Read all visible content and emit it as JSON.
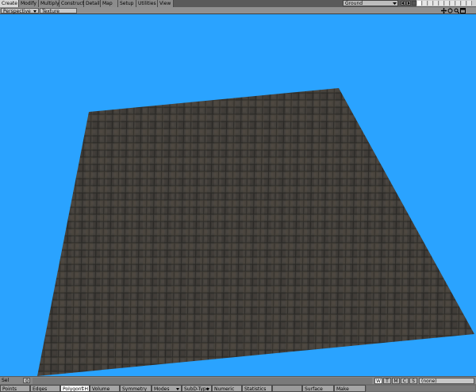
{
  "toolbar": {
    "tabs": [
      "Create",
      "Modify",
      "Multiply",
      "Construct",
      "Detail",
      "Map",
      "Setup",
      "Utilities",
      "View"
    ],
    "active_tab": "Create",
    "layer_object": "Ground"
  },
  "viewport": {
    "view_mode": "Perspective",
    "render_mode": "Texture",
    "background_color": "#2aa3ff",
    "plane_color": "#3b3833"
  },
  "status": {
    "sel_label": "Sel",
    "sel_count": "0",
    "wtmcs": [
      "W",
      "T",
      "M",
      "C",
      "S"
    ],
    "active_wtmcs": "W",
    "surface": "(none)"
  },
  "modes": {
    "points": "Points",
    "edges": "Edges",
    "polygons": "Polygons",
    "polygons_hotkey": "^H",
    "volume": "Volume",
    "symmetry": "Symmetry",
    "modes": "Modes",
    "subd_type": "SubD-Type",
    "numeric": "Numeric",
    "statistics": "Statistics",
    "surface": "Surface",
    "make": "Make"
  }
}
